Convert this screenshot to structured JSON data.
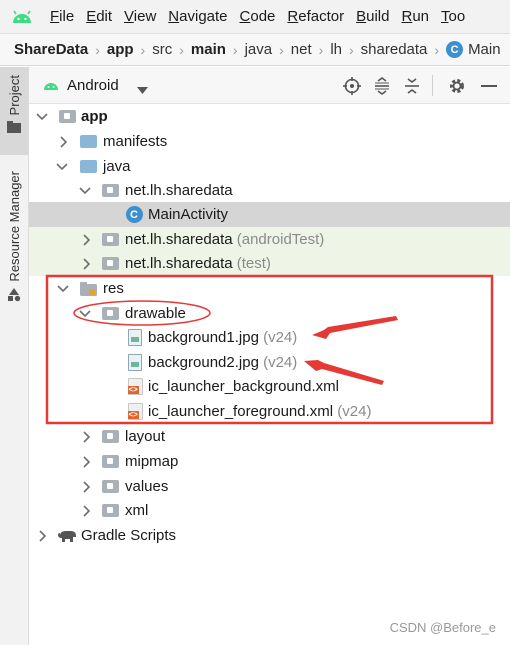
{
  "menu": {
    "items": [
      {
        "mnemonic": "F",
        "rest": "ile"
      },
      {
        "mnemonic": "E",
        "rest": "dit"
      },
      {
        "mnemonic": "V",
        "rest": "iew"
      },
      {
        "mnemonic": "N",
        "rest": "avigate"
      },
      {
        "mnemonic": "C",
        "rest": "ode"
      },
      {
        "mnemonic": "R",
        "rest": "efactor"
      },
      {
        "mnemonic": "B",
        "rest": "uild"
      },
      {
        "mnemonic": "R",
        "rest": "un"
      },
      {
        "mnemonic": "T",
        "rest": "oo"
      }
    ]
  },
  "breadcrumb": {
    "items": [
      "ShareData",
      "app",
      "src",
      "main",
      "java",
      "net",
      "lh",
      "sharedata",
      "Main"
    ]
  },
  "toolstrip": {
    "project": "Project",
    "resource_manager": "Resource Manager"
  },
  "project_panel": {
    "view_mode": "Android"
  },
  "tree": {
    "app": "app",
    "manifests": "manifests",
    "java": "java",
    "pkg_main": "net.lh.sharedata",
    "main_activity": "MainActivity",
    "class_badge": "C",
    "pkg_android_test": "net.lh.sharedata",
    "android_test_suffix": "(androidTest)",
    "pkg_test": "net.lh.sharedata",
    "test_suffix": "(test)",
    "res": "res",
    "drawable": "drawable",
    "bg1": "background1.jpg",
    "bg1_suffix": "(v24)",
    "bg2": "background2.jpg",
    "bg2_suffix": "(v24)",
    "ic_bg": "ic_launcher_background.xml",
    "ic_fg": "ic_launcher_foreground.xml",
    "ic_fg_suffix": "(v24)",
    "layout": "layout",
    "mipmap": "mipmap",
    "values": "values",
    "xml": "xml",
    "gradle": "Gradle Scripts"
  },
  "watermark": "CSDN @Before_e",
  "colors": {
    "android_green": "#3ddc84",
    "annotation_red": "#e53935",
    "selection": "#d5d5d5",
    "test_bg": "#eef5e7"
  }
}
